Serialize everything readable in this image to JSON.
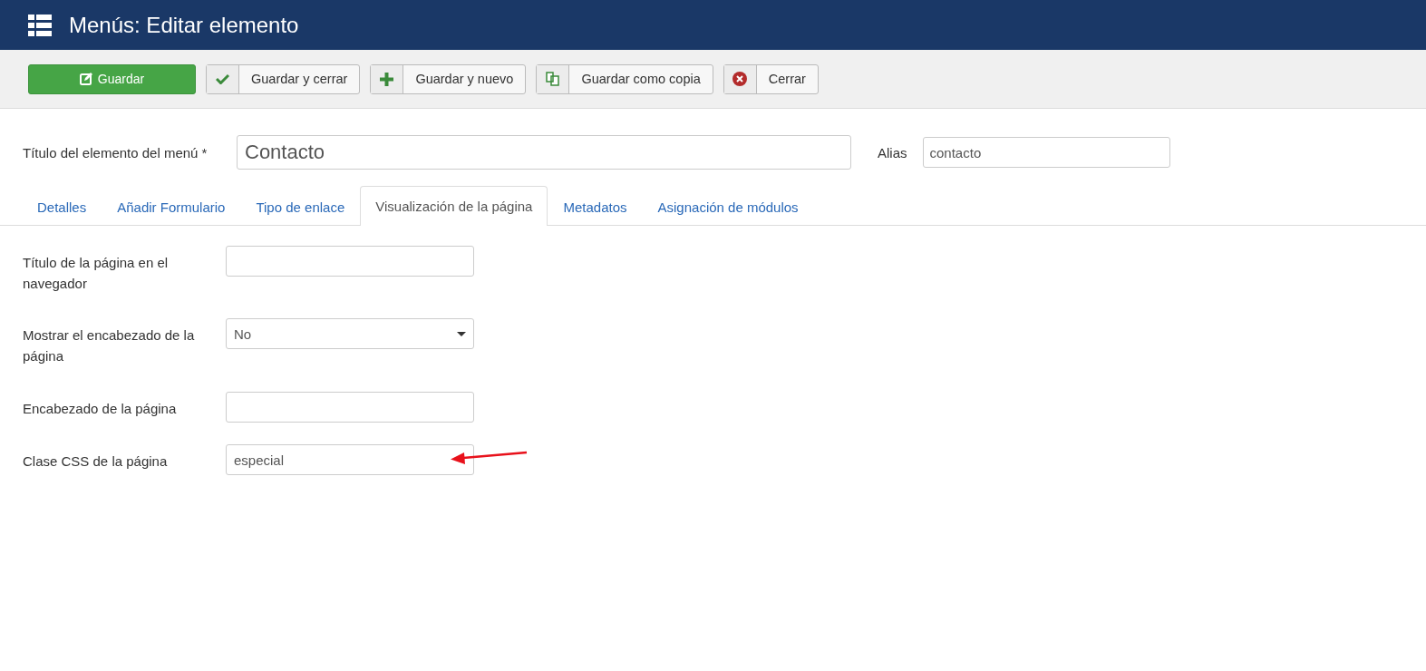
{
  "header": {
    "title": "Menús: Editar elemento"
  },
  "toolbar": [
    {
      "label": "Guardar",
      "kind": "primary"
    },
    {
      "label": "Guardar y cerrar",
      "kind": "split"
    },
    {
      "label": "Guardar y nuevo",
      "kind": "split"
    },
    {
      "label": "Guardar como copia",
      "kind": "split"
    },
    {
      "label": "Cerrar",
      "kind": "split"
    }
  ],
  "title_field": {
    "label": "Título del elemento del menú *",
    "value": "Contacto"
  },
  "alias_field": {
    "label": "Alias",
    "value": "contacto"
  },
  "tabs": [
    {
      "label": "Detalles",
      "selected": false
    },
    {
      "label": "Añadir Formulario",
      "selected": false
    },
    {
      "label": "Tipo de enlace",
      "selected": false
    },
    {
      "label": "Visualización de la página",
      "selected": true
    },
    {
      "label": "Metadatos",
      "selected": false
    },
    {
      "label": "Asignación de módulos",
      "selected": false
    }
  ],
  "fields": [
    {
      "label": "Título de la página en el navegador",
      "kind": "text"
    },
    {
      "label": "Mostrar el encabezado de la página",
      "kind": "select",
      "value": "No"
    },
    {
      "label": "Encabezado de la página",
      "kind": "text"
    },
    {
      "label": "Clase CSS de la página",
      "kind": "text",
      "value": "especial",
      "annotated": true
    }
  ]
}
